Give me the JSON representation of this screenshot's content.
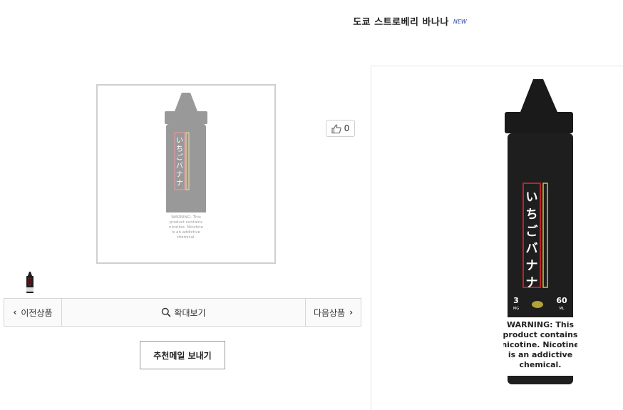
{
  "product": {
    "title": "도쿄 스트로베리 바나나",
    "badge": "NEW"
  },
  "like": {
    "count": "0"
  },
  "nav": {
    "prev_label": "이전상품",
    "zoom_label": "확대보기",
    "next_label": "다음상품"
  },
  "mail_button": {
    "label": "추천메일 보내기"
  },
  "bottle": {
    "label_jp": [
      "い",
      "ち",
      "ご",
      "バ",
      "ナ",
      "ナ"
    ],
    "ml": "60",
    "ml_unit": "ML",
    "mg": "3",
    "mg_unit": "MG",
    "warning_lines": [
      "WARNING: This",
      "product contains",
      "nicotine. Nicotine",
      "is an addictive",
      "chemical."
    ]
  },
  "colors": {
    "bottle_dark": "#1e1e1e",
    "label_red": "#c0202e",
    "label_yellow": "#d8c43a",
    "border": "#cfcfcf"
  }
}
